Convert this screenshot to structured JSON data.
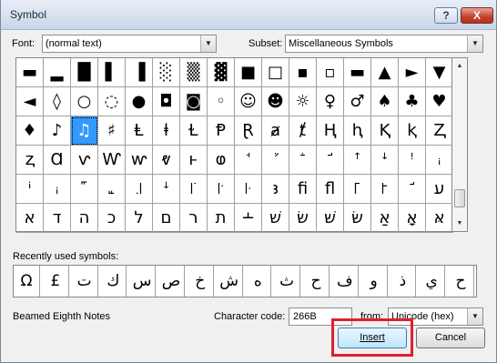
{
  "window": {
    "title": "Symbol",
    "help_glyph": "?",
    "close_glyph": "X"
  },
  "font": {
    "label": "Font:",
    "value": "(normal text)"
  },
  "subset": {
    "label": "Subset:",
    "value": "Miscellaneous Symbols"
  },
  "grid": {
    "rows": [
      [
        "▬",
        "▂",
        "█",
        "▌",
        "▐",
        "░",
        "▒",
        "▓",
        "■",
        "□",
        "▪",
        "▫",
        "▬",
        "▲",
        "►",
        "▼"
      ],
      [
        "◄",
        "◊",
        "○",
        "◌",
        "●",
        "◘",
        "◙",
        "◦",
        "☺",
        "☻",
        "☼",
        "♀",
        "♂",
        "♠",
        "♣",
        "♥"
      ],
      [
        "♦",
        "♪",
        "♫",
        "♯",
        "Ⱡ",
        "ⱡ",
        "Ɫ",
        "Ᵽ",
        "Ɽ",
        "ⱥ",
        "ⱦ",
        "Ⱨ",
        "ⱨ",
        "Ⱪ",
        "ⱪ",
        "Ⱬ"
      ],
      [
        "ⱬ",
        "Ɑ",
        "ⱱ",
        "Ⱳ",
        "ⱳ",
        "ⱴ",
        "ⱶ",
        "ⱷ",
        "ꜗ",
        "ꜘ",
        "ꜙ",
        "ꜚ",
        "ꜛ",
        "ꜜ",
        "ꜝ",
        "ꜟ"
      ],
      [
        "ꜞ",
        "ꜟ",
        "꜠",
        "꜡",
        "꜌",
        "ꜜ",
        "꜍",
        "꜎",
        "꜏",
        "ꜣ",
        "ﬁ",
        "ﬂ",
        "꜒",
        "꜓",
        "ꜚ",
        "ﬠ"
      ],
      [
        "א",
        "ד",
        "ה",
        "כ",
        "ל",
        "ם",
        "ר",
        "ת",
        "﬩",
        "שׁ",
        "שׂ",
        "שּׁ",
        "שּׂ",
        "אַ",
        "אָ",
        "אּ"
      ]
    ],
    "selected": {
      "row": 2,
      "col": 2
    }
  },
  "scrollbar": {
    "up_glyph": "▲",
    "down_glyph": "▼"
  },
  "recent": {
    "label": "Recently used symbols:",
    "symbols": [
      "Ω",
      "£",
      "ت",
      "ك",
      "س",
      "ص",
      "خ",
      "ش",
      "ه",
      "ث",
      "ح",
      "ف",
      "و",
      "ذ",
      "ي",
      "ح"
    ]
  },
  "selected_name": "Beamed Eighth Notes",
  "character_code": {
    "label": "Character code:",
    "value": "266B"
  },
  "from": {
    "label": "from:",
    "value": "Unicode (hex)"
  },
  "buttons": {
    "insert": "Insert",
    "cancel": "Cancel"
  },
  "colors": {
    "selection": "#3399ff",
    "highlight": "#e0202a"
  }
}
